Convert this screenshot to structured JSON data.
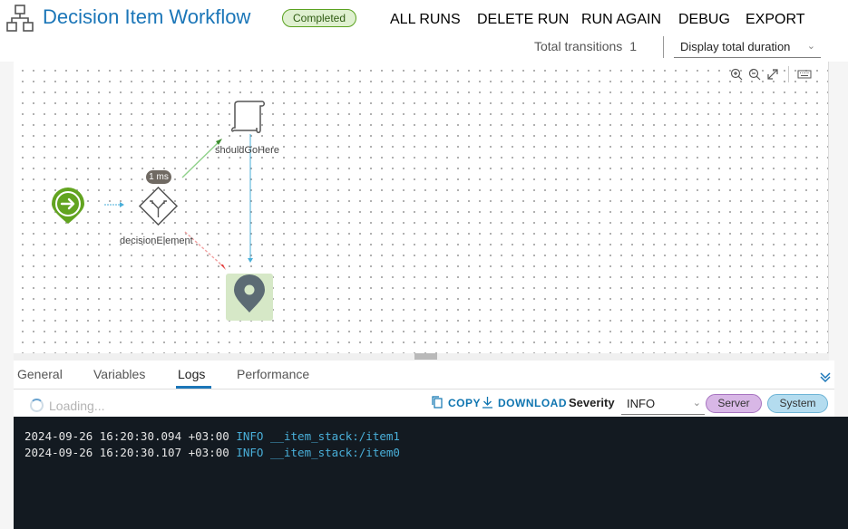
{
  "header": {
    "title": "Decision Item Workflow",
    "status": "Completed",
    "actions": [
      "ALL RUNS",
      "DELETE RUN",
      "RUN AGAIN",
      "DEBUG",
      "EXPORT"
    ],
    "transitions_label": "Total transitions",
    "transitions_count": "1",
    "duration_option": "Display total duration"
  },
  "canvas": {
    "nodes": {
      "decision_label": "decisionElement",
      "script_label": "shouldGoHere",
      "duration_badge": "1 ms"
    }
  },
  "tabs": [
    "General",
    "Variables",
    "Logs",
    "Performance"
  ],
  "active_tab": "Logs",
  "logs": {
    "loading_text": "Loading...",
    "copy_label": "COPY",
    "download_label": "DOWNLOAD",
    "severity_label": "Severity",
    "severity_value": "INFO",
    "filters": [
      "Server",
      "System"
    ],
    "entries": [
      {
        "timestamp": "2024-09-26 16:20:30.094 +03:00",
        "level": "INFO",
        "message": "__item_stack:/item1"
      },
      {
        "timestamp": "2024-09-26 16:20:30.107 +03:00",
        "level": "INFO",
        "message": "__item_stack:/item0"
      }
    ]
  },
  "colors": {
    "accent": "#1b76b8",
    "success": "#5aa220",
    "error_path": "#e23a3a",
    "console_bg": "#131a21"
  },
  "icons": [
    "workflow-icon",
    "start-icon",
    "decision-icon",
    "script-icon",
    "end-icon",
    "zoom-in-icon",
    "zoom-out-icon",
    "fit-icon",
    "keyboard-icon",
    "copy-icon",
    "download-icon",
    "collapse-icon"
  ]
}
